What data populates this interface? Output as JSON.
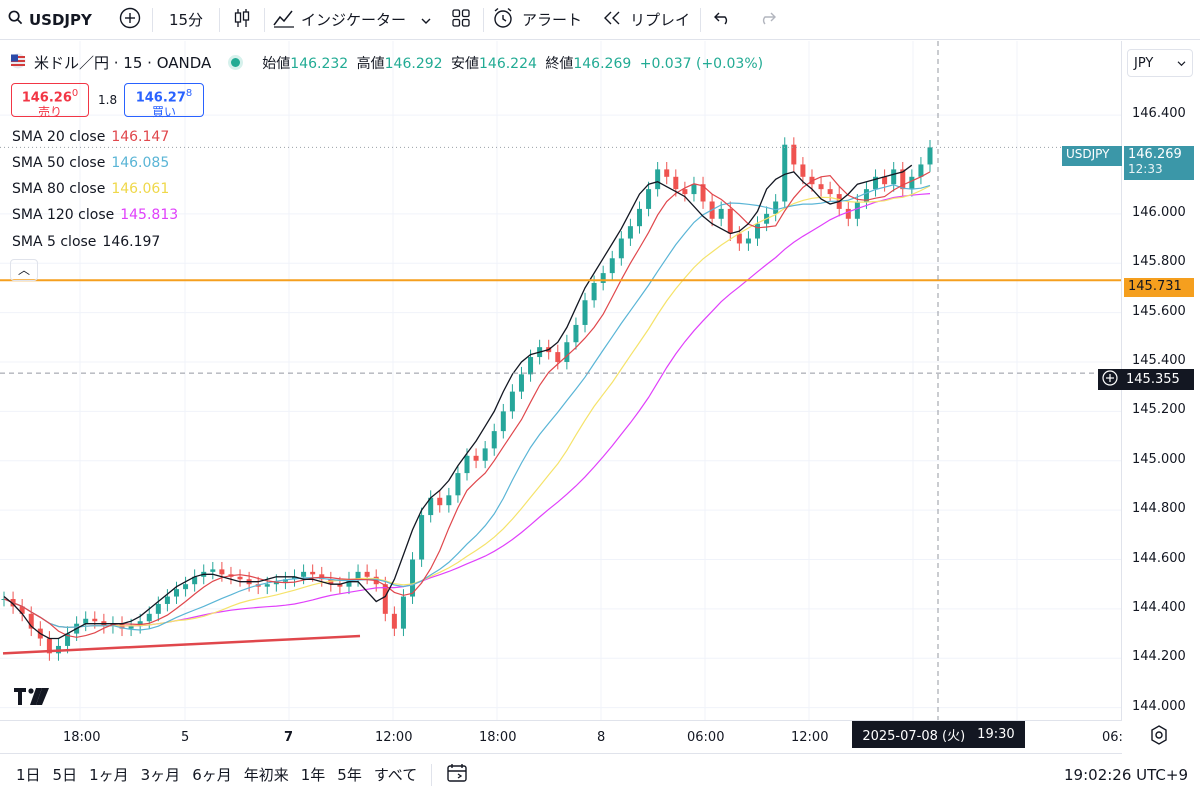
{
  "toolbar": {
    "symbol": "USDJPY",
    "interval": "15分",
    "indicators_label": "インジケーター",
    "alert_label": "アラート",
    "replay_label": "リプレイ"
  },
  "legend": {
    "title": "米ドル／円 · 15 · OANDA",
    "open_label": "始値",
    "open": "146.232",
    "high_label": "高値",
    "high": "146.292",
    "low_label": "安値",
    "low": "146.224",
    "close_label": "終値",
    "close": "146.269",
    "change": "+0.037 (+0.03%)"
  },
  "trade": {
    "sell_price": "146.26",
    "sell_super": "0",
    "sell_label": "売り",
    "spread": "1.8",
    "buy_price": "146.27",
    "buy_super": "8",
    "buy_label": "買い"
  },
  "indicators": [
    {
      "name": "SMA 20 close",
      "value": "146.147",
      "color": "#e0474c"
    },
    {
      "name": "SMA 50 close",
      "value": "146.085",
      "color": "#5ab5d6"
    },
    {
      "name": "SMA 80 close",
      "value": "146.061",
      "color": "#f5e36a"
    },
    {
      "name": "SMA 120 close",
      "value": "145.813",
      "color": "#e040fb"
    },
    {
      "name": "SMA 5 close",
      "value": "146.197",
      "color": "#131722"
    }
  ],
  "price_axis": {
    "currency": "JPY",
    "ticks": [
      "146.400",
      "146.000",
      "145.800",
      "145.600",
      "145.400",
      "145.200",
      "145.000",
      "144.800",
      "144.600",
      "144.400",
      "144.200",
      "144.000"
    ],
    "symbol_tag": "USDJPY",
    "last_price": "146.269",
    "countdown": "12:33",
    "hline_price": "145.731",
    "crosshair_price": "145.355"
  },
  "time_axis": {
    "labels": [
      "18:00",
      "5",
      "7",
      "12:00",
      "18:00",
      "8",
      "06:00",
      "12:00",
      "06:"
    ],
    "crosshair_time": "2025-07-08 (火)",
    "crosshair_hm": "19:30"
  },
  "ranges": [
    "1日",
    "5日",
    "1ヶ月",
    "3ヶ月",
    "6ヶ月",
    "年初来",
    "1年",
    "5年",
    "すべて"
  ],
  "clock": "19:02:26 UTC+9",
  "chart_data": {
    "type": "line",
    "ylim": [
      143.95,
      146.7
    ],
    "ticks": [
      144.0,
      144.2,
      144.4,
      144.6,
      144.8,
      145.0,
      145.2,
      145.4,
      145.6,
      145.8,
      146.0,
      146.4
    ],
    "close": [
      144.44,
      144.41,
      144.38,
      144.32,
      144.28,
      144.22,
      144.25,
      144.3,
      144.34,
      144.36,
      144.35,
      144.33,
      144.34,
      144.32,
      144.33,
      144.35,
      144.38,
      144.42,
      144.45,
      144.48,
      144.5,
      144.53,
      144.55,
      144.56,
      144.54,
      144.53,
      144.52,
      144.5,
      144.49,
      144.5,
      144.51,
      144.52,
      144.53,
      144.55,
      144.54,
      144.52,
      144.5,
      144.49,
      144.52,
      144.55,
      144.53,
      144.5,
      144.38,
      144.32,
      144.45,
      144.6,
      144.78,
      144.85,
      144.82,
      144.86,
      144.95,
      145.02,
      145.0,
      145.05,
      145.12,
      145.2,
      145.28,
      145.35,
      145.42,
      145.46,
      145.44,
      145.4,
      145.48,
      145.55,
      145.65,
      145.72,
      145.76,
      145.82,
      145.9,
      145.95,
      146.02,
      146.1,
      146.18,
      146.15,
      146.1,
      146.08,
      146.12,
      146.05,
      145.98,
      146.02,
      145.92,
      145.88,
      145.9,
      145.96,
      146.0,
      146.05,
      146.28,
      146.2,
      146.15,
      146.12,
      146.1,
      146.08,
      146.02,
      145.98,
      146.05,
      146.1,
      146.15,
      146.12,
      146.18,
      146.1,
      146.15,
      146.2,
      146.269
    ],
    "sma5": [
      144.45,
      144.42,
      144.38,
      144.33,
      144.3,
      144.28,
      144.28,
      144.3,
      144.32,
      144.34,
      144.34,
      144.34,
      144.34,
      144.34,
      144.35,
      144.37,
      144.4,
      144.43,
      144.46,
      144.49,
      144.51,
      144.53,
      144.54,
      144.54,
      144.53,
      144.52,
      144.51,
      144.51,
      144.51,
      144.52,
      144.53,
      144.53,
      144.53,
      144.52,
      144.52,
      144.51,
      144.5,
      144.5,
      144.51,
      144.51,
      144.47,
      144.43,
      144.45,
      144.52,
      144.62,
      144.72,
      144.8,
      144.85,
      144.88,
      144.92,
      144.98,
      145.03,
      145.08,
      145.14,
      145.2,
      145.28,
      145.35,
      145.4,
      145.43,
      145.44,
      145.45,
      145.48,
      145.54,
      145.62,
      145.7,
      145.76,
      145.82,
      145.88,
      145.94,
      146.01,
      146.08,
      146.12,
      146.13,
      146.11,
      146.09,
      146.07,
      146.03,
      145.99,
      145.96,
      145.94,
      145.92,
      145.93,
      145.96,
      146.01,
      146.1,
      146.14,
      146.16,
      146.17,
      146.13,
      146.1,
      146.06,
      146.04,
      146.05,
      146.08,
      146.12,
      146.13,
      146.14,
      146.15,
      146.16,
      146.17,
      146.197
    ]
  }
}
